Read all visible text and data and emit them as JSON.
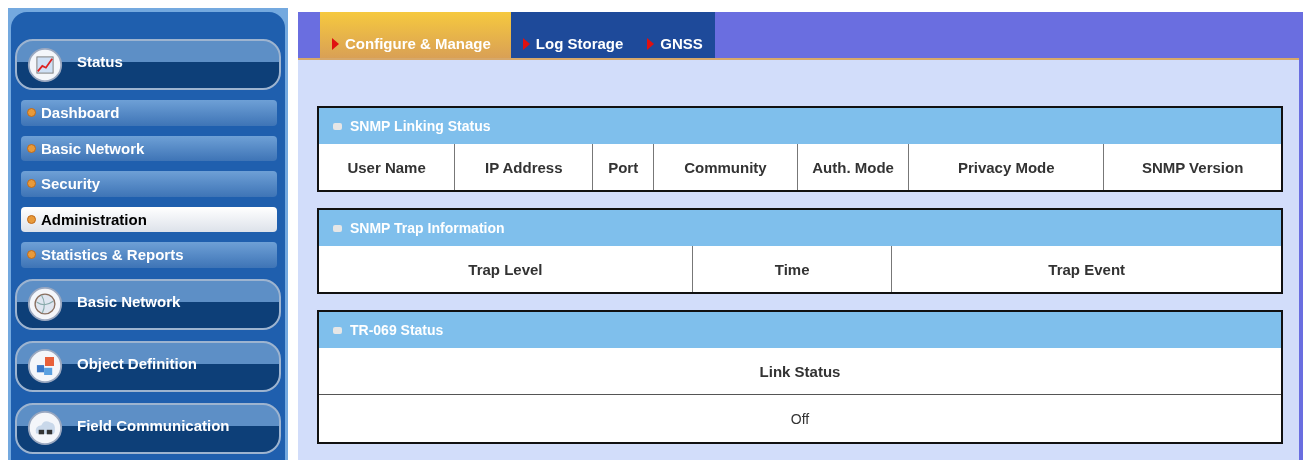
{
  "sidebar": {
    "items": [
      {
        "kind": "main",
        "label": "Status",
        "selected": false
      },
      {
        "kind": "sub",
        "label": "Dashboard",
        "selected": false
      },
      {
        "kind": "sub",
        "label": "Basic Network",
        "selected": false
      },
      {
        "kind": "sub",
        "label": "Security",
        "selected": false
      },
      {
        "kind": "sub",
        "label": "Administration",
        "selected": true
      },
      {
        "kind": "sub",
        "label": "Statistics & Reports",
        "selected": false
      },
      {
        "kind": "main",
        "label": "Basic Network",
        "selected": false
      },
      {
        "kind": "main",
        "label": "Object Definition",
        "selected": false
      },
      {
        "kind": "main",
        "label": "Field Communication",
        "selected": false
      }
    ]
  },
  "tabs": [
    {
      "label": "Configure & Manage",
      "selected": true
    },
    {
      "label": "Log Storage",
      "selected": false
    },
    {
      "label": "GNSS",
      "selected": false
    }
  ],
  "panels": [
    {
      "title": "SNMP Linking Status",
      "columns": [
        "User Name",
        "IP Address",
        "Port",
        "Community",
        "Auth. Mode",
        "Privacy Mode",
        "SNMP Version"
      ]
    },
    {
      "title": "SNMP Trap Information",
      "columns": [
        "Trap Level",
        "Time",
        "Trap Event"
      ]
    },
    {
      "title": "TR-069 Status",
      "columns": [
        "Link Status"
      ],
      "rows": [
        [
          "Off"
        ]
      ]
    }
  ]
}
